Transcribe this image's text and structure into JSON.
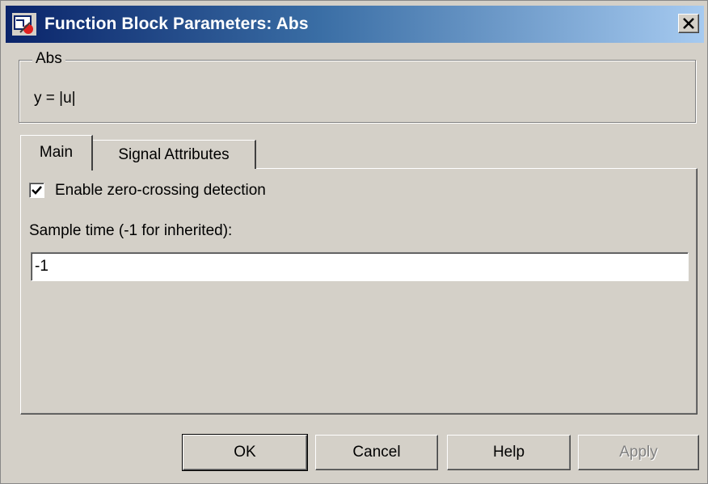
{
  "window": {
    "title": "Function Block Parameters: Abs",
    "close_icon": "close-x-icon",
    "app_icon": "simulink-block-icon"
  },
  "group": {
    "legend": "Abs",
    "description": "y = |u|"
  },
  "tabs": [
    {
      "label": "Main",
      "selected": true
    },
    {
      "label": "Signal Attributes",
      "selected": false
    }
  ],
  "main": {
    "zero_crossing": {
      "label": "Enable zero-crossing detection",
      "checked": true
    },
    "sample_time": {
      "label": "Sample time (-1 for inherited):",
      "value": "-1"
    }
  },
  "buttons": {
    "ok": "OK",
    "cancel": "Cancel",
    "help": "Help",
    "apply": "Apply"
  },
  "colors": {
    "dialog_bg": "#d4d0c8",
    "title_start": "#0a246a",
    "title_end": "#a6caf0",
    "disabled_text": "#808080"
  }
}
